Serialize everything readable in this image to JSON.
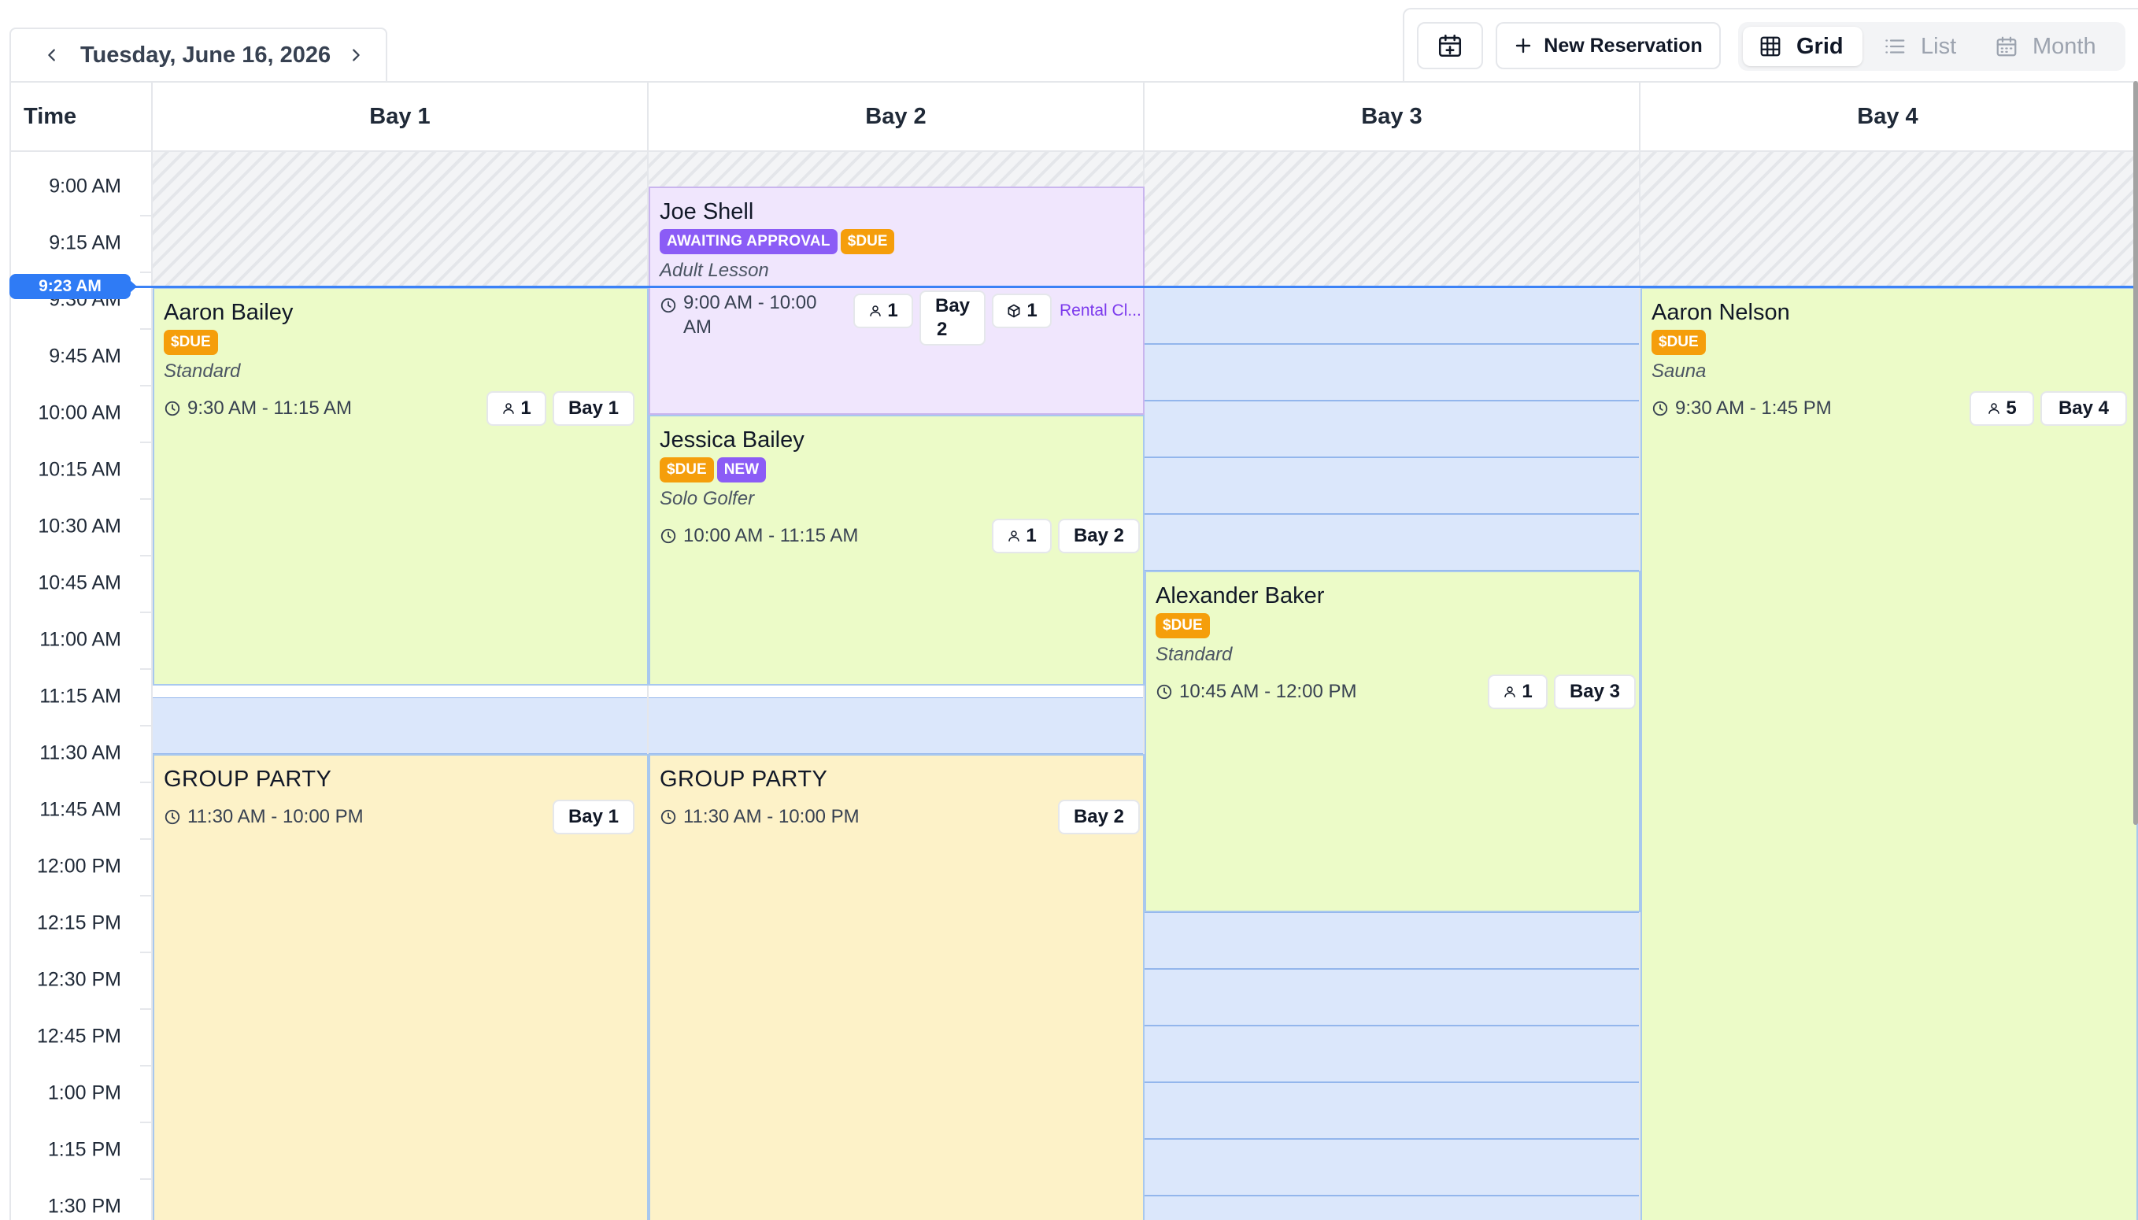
{
  "date_nav": {
    "date": "Tuesday, June 16, 2026"
  },
  "toolbar": {
    "new_reservation": "New Reservation",
    "views": {
      "grid": "Grid",
      "list": "List",
      "month": "Month"
    },
    "active_view": "Grid"
  },
  "grid": {
    "time_header": "Time",
    "bays": [
      "Bay 1",
      "Bay 2",
      "Bay 3",
      "Bay 4"
    ],
    "times": [
      "9:00 AM",
      "9:15 AM",
      "9:30 AM",
      "9:45 AM",
      "10:00 AM",
      "10:15 AM",
      "10:30 AM",
      "10:45 AM",
      "11:00 AM",
      "11:15 AM",
      "11:30 AM",
      "11:45 AM",
      "12:00 PM",
      "12:15 PM",
      "12:30 PM",
      "12:45 PM",
      "1:00 PM",
      "1:15 PM",
      "1:30 PM"
    ],
    "now": "9:23 AM"
  },
  "events": [
    {
      "name": "Aaron Bailey",
      "badges": [
        "$DUE"
      ],
      "type": "Standard",
      "time": "9:30 AM - 11:15 AM",
      "guests": "1",
      "bay": "Bay 1",
      "color": "#ecfbc8"
    },
    {
      "name": "Joe Shell",
      "badges": [
        "AWAITING APPROVAL",
        "$DUE"
      ],
      "type": "Adult Lesson",
      "time_line1": "9:00 AM - 10:00",
      "time_line2": "AM",
      "guests": "1",
      "bay_line1": "Bay",
      "bay_line2": "2",
      "rentals": "1",
      "rental_label": "Rental Cl...",
      "color": "#f0e6fd"
    },
    {
      "name": "Jessica Bailey",
      "badges": [
        "$DUE",
        "NEW"
      ],
      "type": "Solo Golfer",
      "time": "10:00 AM - 11:15 AM",
      "guests": "1",
      "bay": "Bay 2",
      "color": "#ecfbc8"
    },
    {
      "name": "Alexander Baker",
      "badges": [
        "$DUE"
      ],
      "type": "Standard",
      "time": "10:45 AM - 12:00 PM",
      "guests": "1",
      "bay": "Bay 3",
      "color": "#ecfbc8"
    },
    {
      "name": "Aaron Nelson",
      "badges": [
        "$DUE"
      ],
      "type": "Sauna",
      "time": "9:30 AM - 1:45 PM",
      "guests": "5",
      "bay": "Bay 4",
      "color": "#ecfbc8"
    },
    {
      "name": "GROUP PARTY",
      "time": "11:30 AM - 10:00 PM",
      "bay": "Bay 1",
      "color": "#fdf2c8"
    },
    {
      "name": "GROUP PARTY",
      "time": "11:30 AM - 10:00 PM",
      "bay": "Bay 2",
      "color": "#fdf2c8"
    }
  ],
  "colors": {
    "accent": "#2f7bf5",
    "due": "#f59e0b",
    "badge_purple": "#8b5cf6",
    "free_slot": "#dbe7fb"
  }
}
